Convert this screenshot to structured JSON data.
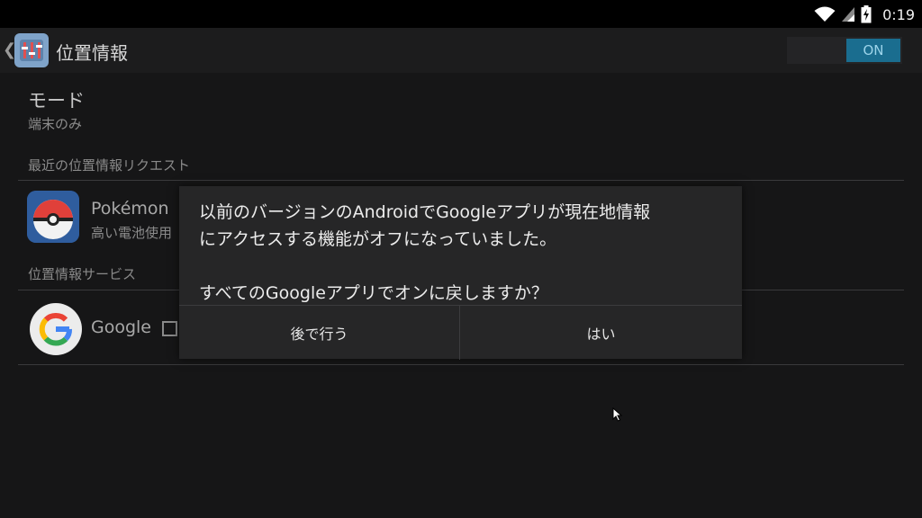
{
  "status_bar": {
    "time": "0:19",
    "icons": [
      "wifi-icon",
      "cellular-signal-icon",
      "battery-charging-icon"
    ]
  },
  "action_bar": {
    "back_icon": "chevron-left-icon",
    "app_icon": "location-settings-icon",
    "title": "位置情報",
    "master_toggle": "ON"
  },
  "settings": {
    "mode": {
      "title": "モード",
      "summary": "端末のみ"
    },
    "recent_requests_header": "最近の位置情報リクエスト",
    "recent_requests": [
      {
        "title": "Pokémon",
        "subtitle": "高い電池使用",
        "icon": "pokeball-icon"
      }
    ],
    "services_header": "位置情報サービス",
    "services": [
      {
        "title": "Google",
        "icon": "google-icon"
      }
    ]
  },
  "dialog": {
    "message": "以前のバージョンのAndroidでGoogleアプリが現在地情報\nにアクセスする機能がオフになっていました。\n\nすべてのGoogleアプリでオンに戻しますか？",
    "negative_button": "後で行う",
    "positive_button": "はい"
  },
  "colors": {
    "toggle_accent": "#1a6d8f",
    "dialog_background": "#262627",
    "screen_background": "#161617"
  }
}
